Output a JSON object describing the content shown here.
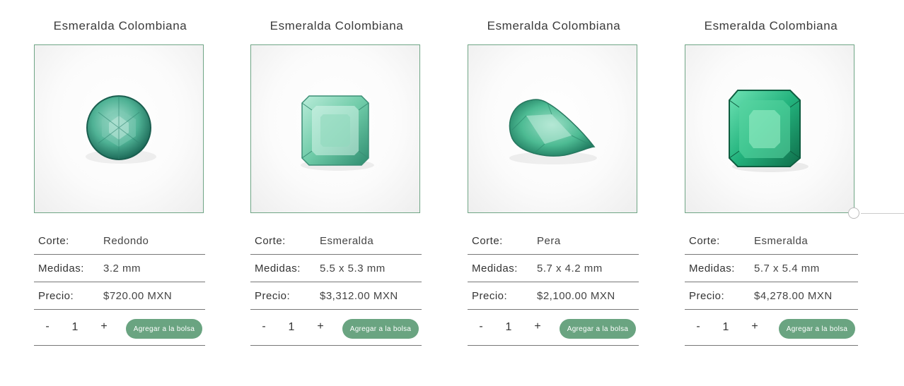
{
  "colors": {
    "accent": "#6aa481",
    "border": "#6fa585",
    "divider": "#777777"
  },
  "labels": {
    "cut": "Corte:",
    "measures": "Medidas:",
    "price": "Precio:"
  },
  "products": [
    {
      "title": "Esmeralda Colombiana",
      "image_icon": "round-emerald-gem",
      "cut": "Redondo",
      "measures": "3.2 mm",
      "price": "$720.00 MXN",
      "minus": "-",
      "qty": "1",
      "plus": "+",
      "cart_label": "Agregar a la bolsa"
    },
    {
      "title": "Esmeralda Colombiana",
      "image_icon": "emerald-cut-gem",
      "cut": "Esmeralda",
      "measures": "5.5 x 5.3 mm",
      "price": "$3,312.00 MXN",
      "minus": "-",
      "qty": "1",
      "plus": "+",
      "cart_label": "Agregar a la bolsa"
    },
    {
      "title": "Esmeralda Colombiana",
      "image_icon": "pear-emerald-gem",
      "cut": "Pera",
      "measures": "5.7 x 4.2 mm",
      "price": "$2,100.00 MXN",
      "minus": "-",
      "qty": "1",
      "plus": "+",
      "cart_label": "Agregar a la bolsa"
    },
    {
      "title": "Esmeralda Colombiana",
      "image_icon": "emerald-cut-gem",
      "cut": "Esmeralda",
      "measures": "5.7 x 5.4 mm",
      "price": "$4,278.00 MXN",
      "minus": "-",
      "qty": "1",
      "plus": "+",
      "cart_label": "Agregar a la bolsa"
    }
  ]
}
